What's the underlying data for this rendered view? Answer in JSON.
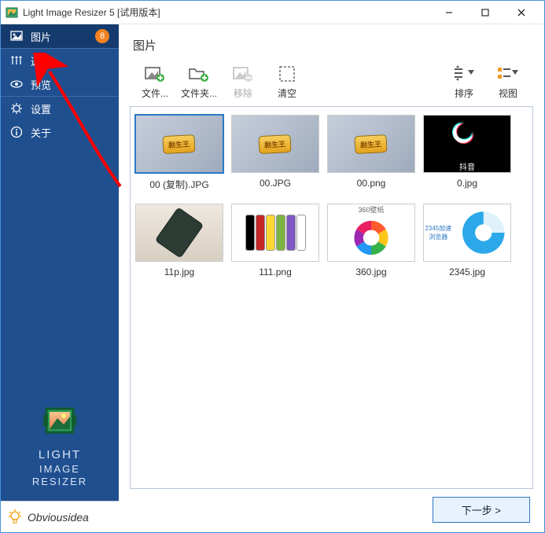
{
  "window": {
    "title": "Light Image Resizer 5  [试用版本]"
  },
  "sidebar": {
    "items": [
      {
        "label": "图片",
        "badge": "8",
        "active": true
      },
      {
        "label": "选项"
      },
      {
        "label": "预览"
      },
      {
        "label": "设置"
      },
      {
        "label": "关于"
      }
    ],
    "brand": {
      "line1": "LIGHT",
      "line2": "IMAGE",
      "line3": "RESIZER"
    },
    "obvious": "Obviousidea"
  },
  "main": {
    "title": "图片"
  },
  "toolbar": {
    "add_file": "文件...",
    "add_folder": "文件夹...",
    "remove": "移除",
    "clear": "清空",
    "sort": "排序",
    "view": "视图"
  },
  "files": [
    {
      "name": "00 (复制).JPG",
      "style": "t-logo",
      "selected": true
    },
    {
      "name": "00.JPG",
      "style": "t-logo"
    },
    {
      "name": "00.png",
      "style": "t-logo"
    },
    {
      "name": "0.jpg",
      "style": "t-black",
      "douyin_caption": "抖音"
    },
    {
      "name": "11p.jpg",
      "style": "t-white"
    },
    {
      "name": "111.png",
      "style": "t-phones"
    },
    {
      "name": "360.jpg",
      "style": "t-360",
      "caption": "360壁纸"
    },
    {
      "name": "2345.jpg",
      "style": "t-2345"
    }
  ],
  "footer": {
    "next": "下一步 >"
  },
  "colors": {
    "sidebar": "#1f4f8f",
    "sidebar_active": "#153b6e",
    "badge": "#f58220",
    "accent": "#2a79c4"
  }
}
